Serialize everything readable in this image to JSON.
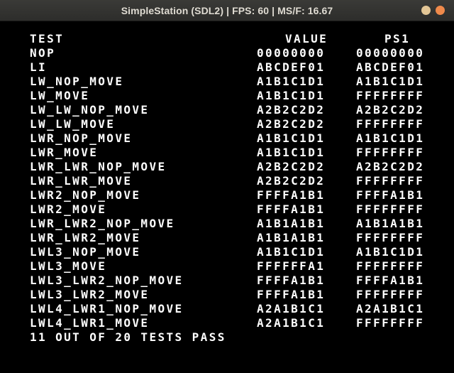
{
  "window": {
    "title": "SimpleStation (SDL2) | FPS: 60 | MS/F: 16.67"
  },
  "table": {
    "headers": {
      "test": "TEST",
      "value": "VALUE",
      "ps1": "PS1"
    },
    "rows": [
      {
        "test": "NOP",
        "value": "00000000",
        "ps1": "00000000"
      },
      {
        "test": "LI",
        "value": "ABCDEF01",
        "ps1": "ABCDEF01"
      },
      {
        "test": "LW_NOP_MOVE",
        "value": "A1B1C1D1",
        "ps1": "A1B1C1D1"
      },
      {
        "test": "LW_MOVE",
        "value": "A1B1C1D1",
        "ps1": "FFFFFFFF"
      },
      {
        "test": "LW_LW_NOP_MOVE",
        "value": "A2B2C2D2",
        "ps1": "A2B2C2D2"
      },
      {
        "test": "LW_LW_MOVE",
        "value": "A2B2C2D2",
        "ps1": "FFFFFFFF"
      },
      {
        "test": "LWR_NOP_MOVE",
        "value": "A1B1C1D1",
        "ps1": "A1B1C1D1"
      },
      {
        "test": "LWR_MOVE",
        "value": "A1B1C1D1",
        "ps1": "FFFFFFFF"
      },
      {
        "test": "LWR_LWR_NOP_MOVE",
        "value": "A2B2C2D2",
        "ps1": "A2B2C2D2"
      },
      {
        "test": "LWR_LWR_MOVE",
        "value": "A2B2C2D2",
        "ps1": "FFFFFFFF"
      },
      {
        "test": "LWR2_NOP_MOVE",
        "value": "FFFFA1B1",
        "ps1": "FFFFA1B1"
      },
      {
        "test": "LWR2_MOVE",
        "value": "FFFFA1B1",
        "ps1": "FFFFFFFF"
      },
      {
        "test": "LWR_LWR2_NOP_MOVE",
        "value": "A1B1A1B1",
        "ps1": "A1B1A1B1"
      },
      {
        "test": "LWR_LWR2_MOVE",
        "value": "A1B1A1B1",
        "ps1": "FFFFFFFF"
      },
      {
        "test": "LWL3_NOP_MOVE",
        "value": "A1B1C1D1",
        "ps1": "A1B1C1D1"
      },
      {
        "test": "LWL3_MOVE",
        "value": "FFFFFFA1",
        "ps1": "FFFFFFFF"
      },
      {
        "test": "LWL3_LWR2_NOP_MOVE",
        "value": "FFFFA1B1",
        "ps1": "FFFFA1B1"
      },
      {
        "test": "LWL3_LWR2_MOVE",
        "value": "FFFFA1B1",
        "ps1": "FFFFFFFF"
      },
      {
        "test": "LWL4_LWR1_NOP_MOVE",
        "value": "A2A1B1C1",
        "ps1": "A2A1B1C1"
      },
      {
        "test": "LWL4_LWR1_MOVE",
        "value": "A2A1B1C1",
        "ps1": "FFFFFFFF"
      }
    ],
    "summary": "11 OUT OF 20 TESTS PASS"
  },
  "colors": {
    "text": "#ffffff",
    "background": "#000000",
    "titlebar": "#2f2f2d",
    "minimize_button": "#e3c696",
    "close_button": "#f08a4b"
  }
}
